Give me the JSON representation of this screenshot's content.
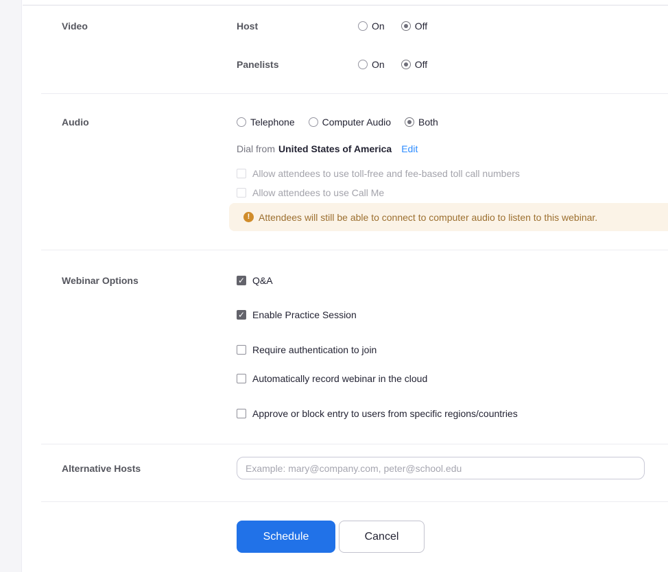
{
  "sections": {
    "video": {
      "label": "Video",
      "rows": [
        {
          "label": "Host",
          "options": [
            "On",
            "Off"
          ],
          "selected": "Off"
        },
        {
          "label": "Panelists",
          "options": [
            "On",
            "Off"
          ],
          "selected": "Off"
        }
      ]
    },
    "audio": {
      "label": "Audio",
      "options": [
        "Telephone",
        "Computer Audio",
        "Both"
      ],
      "selected": "Both",
      "dial_from_prefix": "Dial from",
      "dial_from_country": "United States of America",
      "edit_label": "Edit",
      "checkboxes": [
        {
          "label": "Allow attendees to use toll-free and fee-based toll call numbers",
          "checked": false,
          "disabled": true
        },
        {
          "label": "Allow attendees to use Call Me",
          "checked": false,
          "disabled": true
        }
      ],
      "notice": "Attendees will still be able to connect to computer audio to listen to this webinar."
    },
    "webinar_options": {
      "label": "Webinar Options",
      "checkboxes": [
        {
          "label": "Q&A",
          "checked": true
        },
        {
          "label": "Enable Practice Session",
          "checked": true
        },
        {
          "label": "Require authentication to join",
          "checked": false
        },
        {
          "label": "Automatically record webinar in the cloud",
          "checked": false
        },
        {
          "label": "Approve or block entry to users from specific regions/countries",
          "checked": false
        }
      ]
    },
    "alternative_hosts": {
      "label": "Alternative Hosts",
      "placeholder": "Example: mary@company.com, peter@school.edu",
      "value": ""
    }
  },
  "footer": {
    "schedule_label": "Schedule",
    "cancel_label": "Cancel"
  },
  "colors": {
    "primary_button": "#2172e8",
    "link_blue": "#2d8cff",
    "warning_bg": "#fbf3e7",
    "warning_icon": "#d08c2b",
    "warning_text": "#9c6f2f",
    "checkbox_checked": "#63636b"
  }
}
